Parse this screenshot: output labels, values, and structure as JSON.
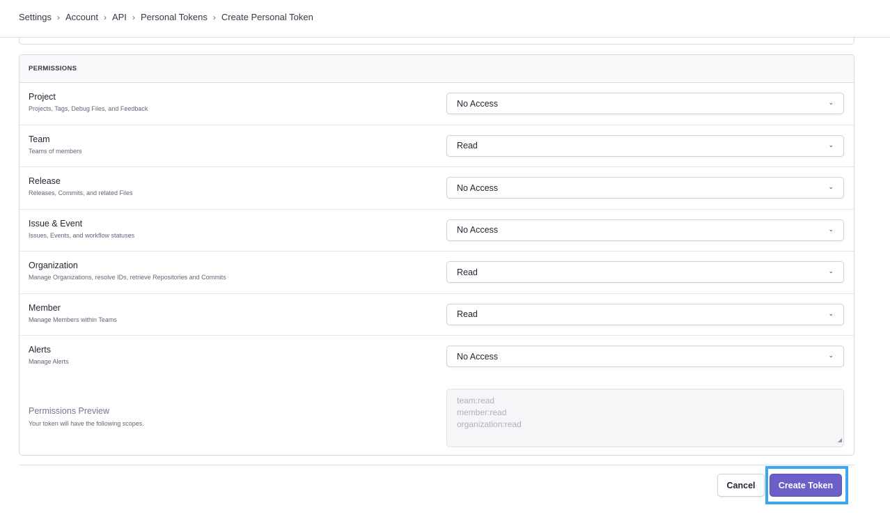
{
  "breadcrumb": [
    "Settings",
    "Account",
    "API",
    "Personal Tokens",
    "Create Personal Token"
  ],
  "permissions": {
    "header": "PERMISSIONS",
    "rows": [
      {
        "label": "Project",
        "description": "Projects, Tags, Debug Files, and Feedback",
        "value": "No Access"
      },
      {
        "label": "Team",
        "description": "Teams of members",
        "value": "Read"
      },
      {
        "label": "Release",
        "description": "Releases, Commits, and related Files",
        "value": "No Access"
      },
      {
        "label": "Issue & Event",
        "description": "Issues, Events, and workflow statuses",
        "value": "No Access"
      },
      {
        "label": "Organization",
        "description": "Manage Organizations, resolve IDs, retrieve Repositories and Commits",
        "value": "Read"
      },
      {
        "label": "Member",
        "description": "Manage Members within Teams",
        "value": "Read"
      },
      {
        "label": "Alerts",
        "description": "Manage Alerts",
        "value": "No Access"
      }
    ],
    "preview": {
      "label": "Permissions Preview",
      "description": "Your token will have the following scopes.",
      "scopes": [
        "team:read",
        "member:read",
        "organization:read"
      ]
    }
  },
  "actions": {
    "cancel_label": "Cancel",
    "create_label": "Create Token"
  },
  "colors": {
    "accent": "#6c5fc7",
    "focus_ring": "#3aa7f0"
  }
}
